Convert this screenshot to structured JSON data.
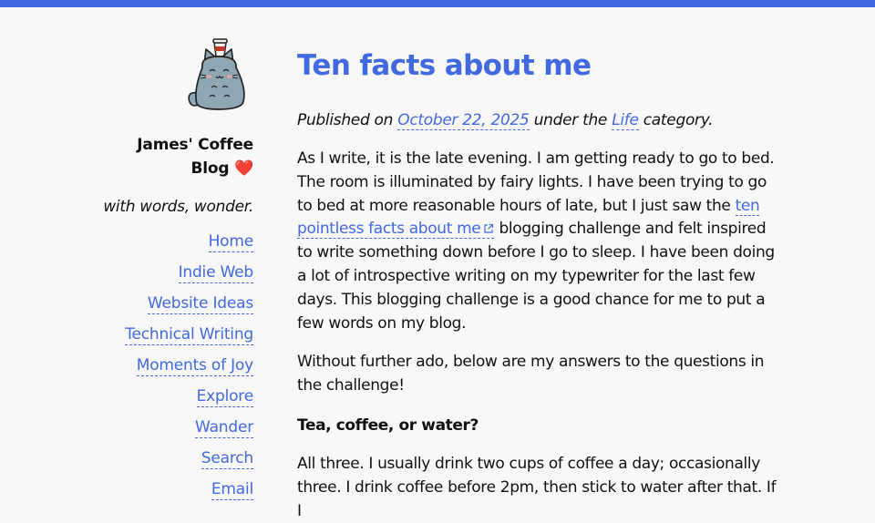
{
  "colors": {
    "accent": "#4169e1",
    "heart": "#e0272f",
    "background": "#f8f8f8"
  },
  "sidebar": {
    "avatar_icon": "cat-with-coffee-icon",
    "title_line1": "James' Coffee",
    "title_line2": "Blog",
    "title_emoji": "❤️",
    "tagline": "with words, wonder.",
    "nav": [
      {
        "label": "Home"
      },
      {
        "label": "Indie Web"
      },
      {
        "label": "Website Ideas"
      },
      {
        "label": "Technical Writing"
      },
      {
        "label": "Moments of Joy"
      },
      {
        "label": "Explore"
      },
      {
        "label": "Wander"
      },
      {
        "label": "Search"
      },
      {
        "label": "Email"
      }
    ]
  },
  "post": {
    "title": "Ten facts about me",
    "meta": {
      "prefix": "Published on",
      "date": "October 22, 2025",
      "middle": "under the",
      "category": "Life",
      "suffix": "category."
    },
    "p1": {
      "before": "As I write, it is the late evening. I am getting ready to go to bed. The room is illuminated by fairy lights. I have been trying to go to bed at more reasonable hours of late, but I just saw the",
      "link": "ten pointless facts about me",
      "after": "blogging challenge and felt inspired to write something down before I go to sleep. I have been doing a lot of introspective writing on my typewriter for the last few days. This blogging challenge is a good chance for me to put a few words on my blog."
    },
    "p2": "Without further ado, below are my answers to the questions in the challenge!",
    "question1": "Tea, coffee, or water?",
    "answer1": "All three. I usually drink two cups of coffee a day; occasionally three. I drink coffee before 2pm, then stick to water after that. If I"
  }
}
